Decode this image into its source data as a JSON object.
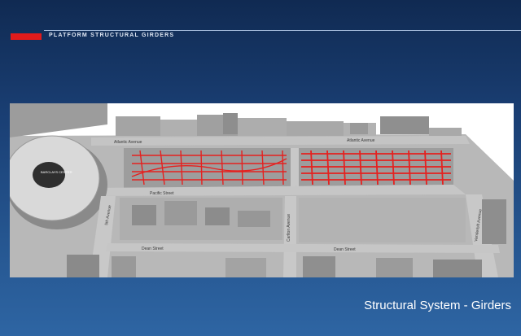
{
  "header": {
    "accent_color": "#e11b1b",
    "section_label": "PLATFORM STRUCTURAL GIRDERS"
  },
  "rendering": {
    "streets": {
      "atlantic_left": "Atlantic Avenue",
      "atlantic_right": "Atlantic Avenue",
      "pacific": "Pacific Street",
      "dean_left": "Dean Street",
      "dean_right": "Dean Street",
      "fifth": "5th Avenue",
      "carlton": "Carlton Avenue",
      "vanderbilt": "Vanderbilt Avenue"
    },
    "arena_sign": "BARCLAYS CENTER",
    "girder_color": "#e5211f"
  },
  "footer": {
    "caption": "Structural System - Girders"
  }
}
